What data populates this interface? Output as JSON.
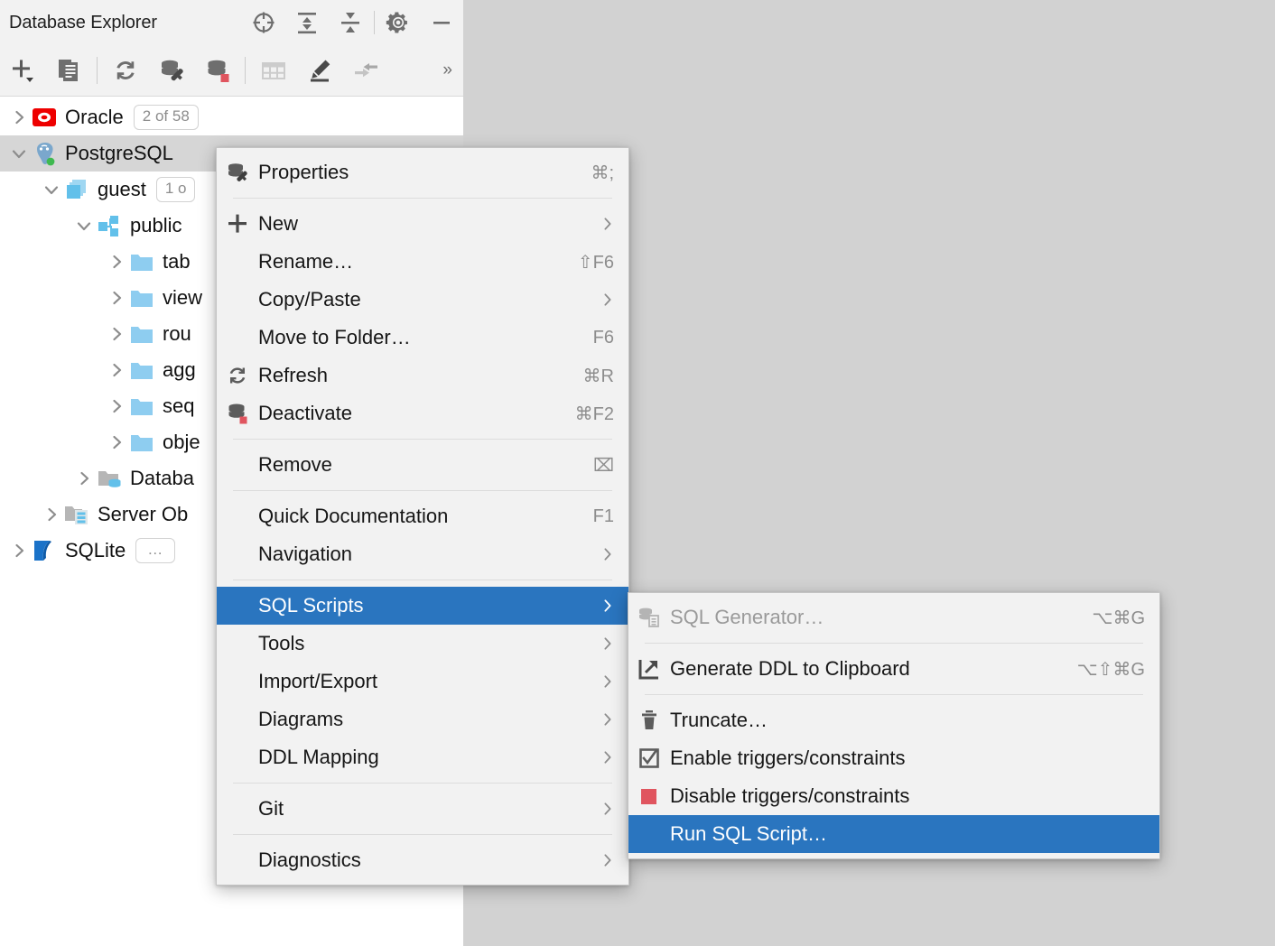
{
  "panel": {
    "title": "Database Explorer",
    "header_buttons": [
      {
        "name": "locate-icon",
        "tip": "Scroll from Source"
      },
      {
        "name": "expand-all-icon",
        "tip": "Expand All"
      },
      {
        "name": "collapse-all-icon",
        "tip": "Collapse All"
      },
      {
        "name": "settings-gear-icon",
        "tip": "Options"
      },
      {
        "name": "minimize-icon",
        "tip": "Hide"
      }
    ],
    "toolbar_buttons": [
      {
        "name": "add-new-icon",
        "tip": "New"
      },
      {
        "name": "duplicate-icon",
        "tip": "Duplicate"
      },
      {
        "name": "refresh-icon",
        "tip": "Refresh"
      },
      {
        "name": "data-source-properties-icon",
        "tip": "Properties"
      },
      {
        "name": "deactivate-data-source-icon",
        "tip": "Deactivate"
      },
      {
        "name": "table-editor-icon",
        "tip": "Table Editor"
      },
      {
        "name": "modify-icon",
        "tip": "Modify"
      },
      {
        "name": "jump-to-console-icon",
        "tip": "Jump to Console"
      }
    ],
    "overflow_label": "»"
  },
  "tree": [
    {
      "indent": 0,
      "arrow": "right",
      "icon": "oracle-icon",
      "label": "Oracle",
      "badge": "2 of 58",
      "selected": false
    },
    {
      "indent": 0,
      "arrow": "down",
      "icon": "postgresql-icon",
      "label": "PostgreSQL",
      "badge": "",
      "selected": true
    },
    {
      "indent": 1,
      "arrow": "down",
      "icon": "database-icon",
      "label": "guest",
      "badge": "1 o",
      "selected": false
    },
    {
      "indent": 2,
      "arrow": "down",
      "icon": "schema-icon",
      "label": "public",
      "badge": "",
      "selected": false
    },
    {
      "indent": 3,
      "arrow": "right",
      "icon": "folder-icon",
      "label": "tab",
      "badge": "",
      "selected": false
    },
    {
      "indent": 3,
      "arrow": "right",
      "icon": "folder-icon",
      "label": "view",
      "badge": "",
      "selected": false
    },
    {
      "indent": 3,
      "arrow": "right",
      "icon": "folder-icon",
      "label": "rou",
      "badge": "",
      "selected": false
    },
    {
      "indent": 3,
      "arrow": "right",
      "icon": "folder-icon",
      "label": "agg",
      "badge": "",
      "selected": false
    },
    {
      "indent": 3,
      "arrow": "right",
      "icon": "folder-icon",
      "label": "seq",
      "badge": "",
      "selected": false
    },
    {
      "indent": 3,
      "arrow": "right",
      "icon": "folder-icon",
      "label": "obje",
      "badge": "",
      "selected": false
    },
    {
      "indent": 2,
      "arrow": "right",
      "icon": "database-folder-icon",
      "label": "Databa",
      "badge": "",
      "selected": false
    },
    {
      "indent": 1,
      "arrow": "right",
      "icon": "server-objects-icon",
      "label": "Server Ob",
      "badge": "",
      "selected": false
    },
    {
      "indent": 0,
      "arrow": "right",
      "icon": "sqlite-icon",
      "label": "SQLite",
      "badge": "…",
      "selected": false
    }
  ],
  "context_menu": {
    "items": [
      {
        "type": "item",
        "icon": "data-source-properties-icon",
        "label": "Properties",
        "shortcut": "⌘;",
        "submenu": false,
        "disabled": false
      },
      {
        "type": "sep"
      },
      {
        "type": "item",
        "icon": "plus-icon",
        "label": "New",
        "shortcut": "",
        "submenu": true,
        "disabled": false
      },
      {
        "type": "item",
        "icon": "",
        "label": "Rename…",
        "shortcut": "⇧F6",
        "submenu": false,
        "disabled": false
      },
      {
        "type": "item",
        "icon": "",
        "label": "Copy/Paste",
        "shortcut": "",
        "submenu": true,
        "disabled": false
      },
      {
        "type": "item",
        "icon": "",
        "label": "Move to Folder…",
        "shortcut": "F6",
        "submenu": false,
        "disabled": false
      },
      {
        "type": "item",
        "icon": "refresh-icon",
        "label": "Refresh",
        "shortcut": "⌘R",
        "submenu": false,
        "disabled": false
      },
      {
        "type": "item",
        "icon": "deactivate-data-source-icon",
        "label": "Deactivate",
        "shortcut": "⌘F2",
        "submenu": false,
        "disabled": false
      },
      {
        "type": "sep"
      },
      {
        "type": "item",
        "icon": "",
        "label": "Remove",
        "shortcut": "⌧",
        "submenu": false,
        "disabled": false
      },
      {
        "type": "sep"
      },
      {
        "type": "item",
        "icon": "",
        "label": "Quick Documentation",
        "shortcut": "F1",
        "submenu": false,
        "disabled": false
      },
      {
        "type": "item",
        "icon": "",
        "label": "Navigation",
        "shortcut": "",
        "submenu": true,
        "disabled": false
      },
      {
        "type": "sep"
      },
      {
        "type": "item",
        "icon": "",
        "label": "SQL Scripts",
        "shortcut": "",
        "submenu": true,
        "disabled": false,
        "highlighted": true
      },
      {
        "type": "item",
        "icon": "",
        "label": "Tools",
        "shortcut": "",
        "submenu": true,
        "disabled": false
      },
      {
        "type": "item",
        "icon": "",
        "label": "Import/Export",
        "shortcut": "",
        "submenu": true,
        "disabled": false
      },
      {
        "type": "item",
        "icon": "",
        "label": "Diagrams",
        "shortcut": "",
        "submenu": true,
        "disabled": false
      },
      {
        "type": "item",
        "icon": "",
        "label": "DDL Mapping",
        "shortcut": "",
        "submenu": true,
        "disabled": false
      },
      {
        "type": "sep"
      },
      {
        "type": "item",
        "icon": "",
        "label": "Git",
        "shortcut": "",
        "submenu": true,
        "disabled": false
      },
      {
        "type": "sep"
      },
      {
        "type": "item",
        "icon": "",
        "label": "Diagnostics",
        "shortcut": "",
        "submenu": true,
        "disabled": false
      }
    ]
  },
  "sub_menu": {
    "items": [
      {
        "type": "item",
        "icon": "sql-generator-icon",
        "label": "SQL Generator…",
        "shortcut": "⌥⌘G",
        "disabled": true
      },
      {
        "type": "sep"
      },
      {
        "type": "item",
        "icon": "export-arrow-icon",
        "label": "Generate DDL to Clipboard",
        "shortcut": "⌥⇧⌘G",
        "disabled": false
      },
      {
        "type": "sep"
      },
      {
        "type": "item",
        "icon": "trash-icon",
        "label": "Truncate…",
        "shortcut": "",
        "disabled": false
      },
      {
        "type": "item",
        "icon": "checkbox-checked-icon",
        "label": "Enable triggers/constraints",
        "shortcut": "",
        "disabled": false
      },
      {
        "type": "item",
        "icon": "red-square-icon",
        "label": "Disable triggers/constraints",
        "shortcut": "",
        "disabled": false
      },
      {
        "type": "item",
        "icon": "",
        "label": "Run SQL Script…",
        "shortcut": "",
        "disabled": false,
        "highlighted": true
      }
    ]
  },
  "colors": {
    "accent_blue": "#2a75bf",
    "panel_bg": "#f2f2f2",
    "tree_bg": "#ffffff",
    "desktop_bg": "#d2d2d2",
    "folder_blue": "#8ecdf0",
    "oracle_red": "#ee0000",
    "sqlite_blue": "#1a72c8",
    "status_green": "#3fb950",
    "status_red": "#e0555f"
  }
}
